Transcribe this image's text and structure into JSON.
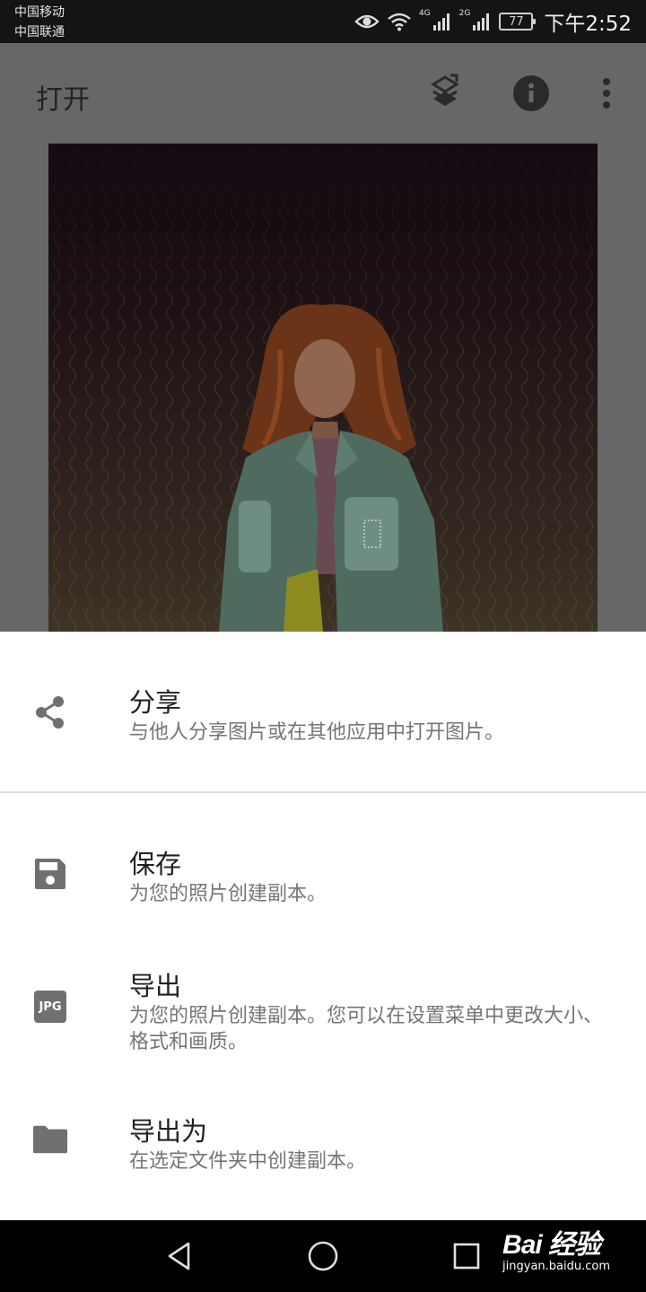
{
  "status_bar": {
    "carrier_1": "中国移动",
    "carrier_2": "中国联通",
    "network_1": "4G",
    "network_2": "2G",
    "battery": "77",
    "time": "下午2:52"
  },
  "app_bar": {
    "title": "打开",
    "actions": [
      "layers-icon",
      "info-icon",
      "more-vert-icon"
    ]
  },
  "sheet": {
    "items": [
      {
        "icon": "share-icon",
        "title": "分享",
        "description": "与他人分享图片或在其他应用中打开图片。"
      },
      {
        "icon": "save-icon",
        "title": "保存",
        "description": "为您的照片创建副本。"
      },
      {
        "icon": "jpg-icon",
        "icon_label": "JPG",
        "title": "导出",
        "description": "为您的照片创建副本。您可以在设置菜单中更改大小、格式和画质。"
      },
      {
        "icon": "folder-icon",
        "title": "导出为",
        "description": "在选定文件夹中创建副本。"
      }
    ]
  },
  "nav_bar": {
    "buttons": [
      "back-icon",
      "home-icon",
      "recents-icon"
    ]
  },
  "watermark": {
    "logo": "Bai 经验",
    "url": "jingyan.baidu.com"
  },
  "colors": {
    "sheet_background": "#ffffff",
    "scrim": "#676767",
    "icon_gray": "#707070",
    "title_text": "#212121",
    "description_text": "#757575"
  }
}
